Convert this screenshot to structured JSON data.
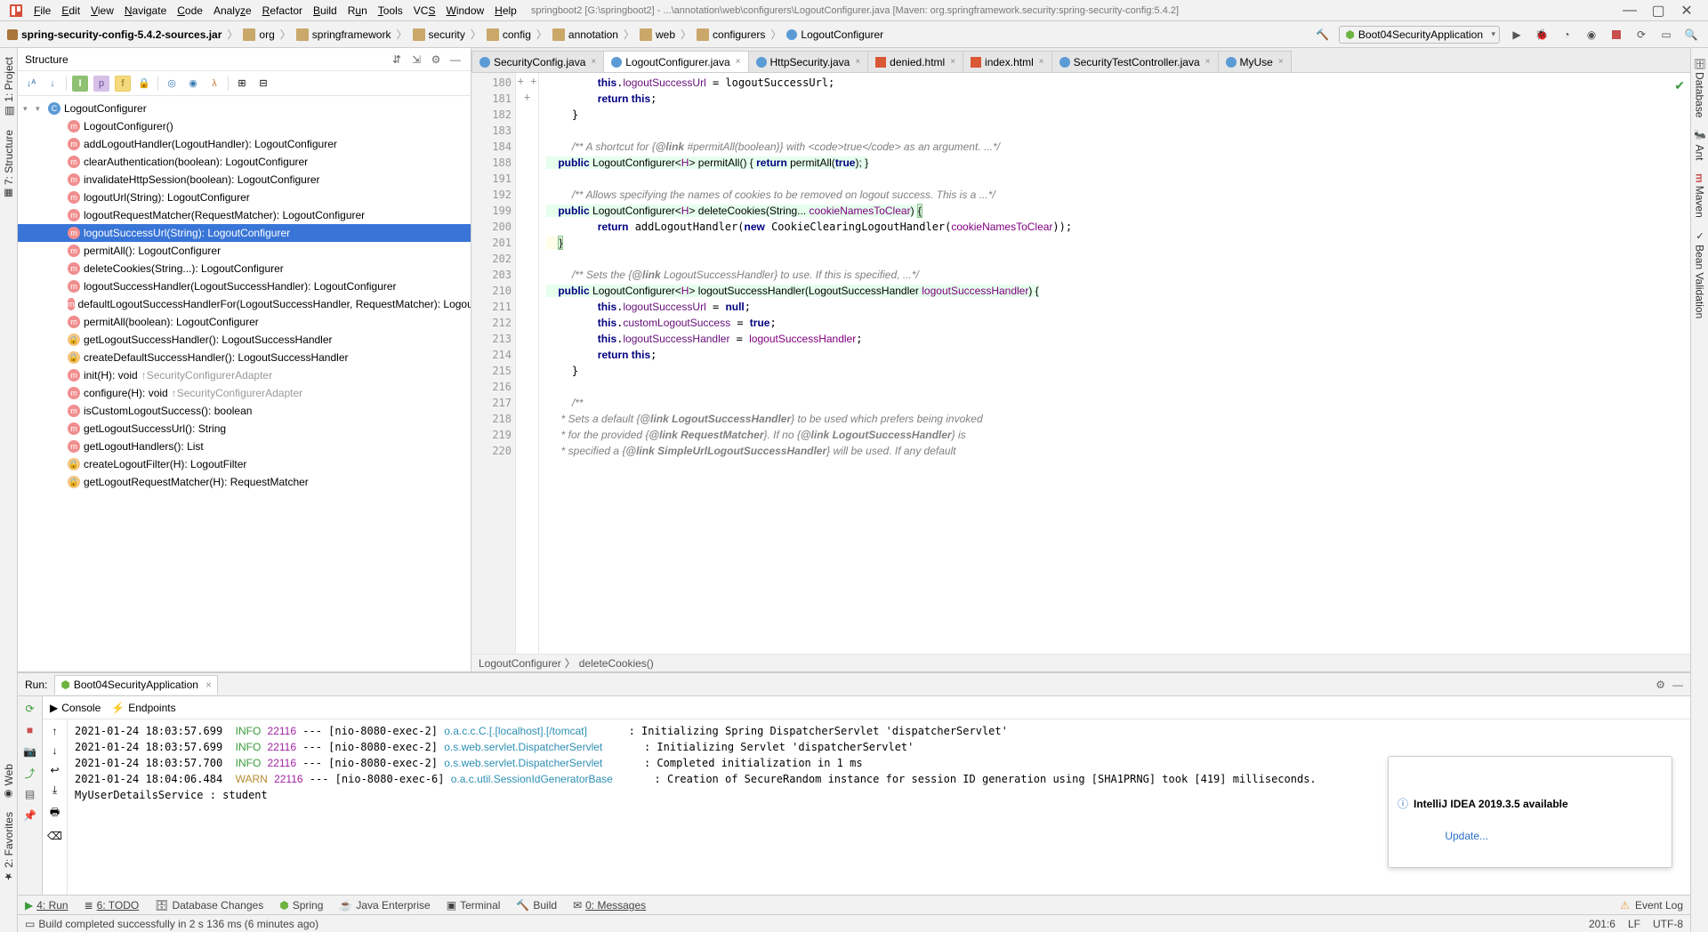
{
  "window": {
    "title": "springboot2 [G:\\springboot2] - ...\\annotation\\web\\configurers\\LogoutConfigurer.java [Maven: org.springframework.security:spring-security-config:5.4.2]"
  },
  "menu": [
    "File",
    "Edit",
    "View",
    "Navigate",
    "Code",
    "Analyze",
    "Refactor",
    "Build",
    "Run",
    "Tools",
    "VCS",
    "Window",
    "Help"
  ],
  "breadcrumbs": [
    "spring-security-config-5.4.2-sources.jar",
    "org",
    "springframework",
    "security",
    "config",
    "annotation",
    "web",
    "configurers",
    "LogoutConfigurer"
  ],
  "runConfig": "Boot04SecurityApplication",
  "leftRail": [
    "1: Project",
    "7: Structure"
  ],
  "rightRail": [
    "Database",
    "Ant",
    "Maven",
    "Bean Validation"
  ],
  "leftRailLower": [
    "2: Favorites",
    "Web"
  ],
  "structure": {
    "title": "Structure",
    "root": "LogoutConfigurer",
    "items": [
      {
        "icon": "m",
        "label": "LogoutConfigurer()"
      },
      {
        "icon": "m",
        "label": "addLogoutHandler(LogoutHandler): LogoutConfigurer<H>"
      },
      {
        "icon": "m",
        "label": "clearAuthentication(boolean): LogoutConfigurer<H>"
      },
      {
        "icon": "m",
        "label": "invalidateHttpSession(boolean): LogoutConfigurer<H>"
      },
      {
        "icon": "m",
        "label": "logoutUrl(String): LogoutConfigurer<H>"
      },
      {
        "icon": "m",
        "label": "logoutRequestMatcher(RequestMatcher): LogoutConfigurer<H>"
      },
      {
        "icon": "m",
        "label": "logoutSuccessUrl(String): LogoutConfigurer<H>",
        "selected": true
      },
      {
        "icon": "m",
        "label": "permitAll(): LogoutConfigurer<H>"
      },
      {
        "icon": "m",
        "label": "deleteCookies(String...): LogoutConfigurer<H>"
      },
      {
        "icon": "m",
        "label": "logoutSuccessHandler(LogoutSuccessHandler): LogoutConfigurer<H>"
      },
      {
        "icon": "m",
        "label": "defaultLogoutSuccessHandlerFor(LogoutSuccessHandler, RequestMatcher): LogoutC"
      },
      {
        "icon": "m",
        "label": "permitAll(boolean): LogoutConfigurer<H>"
      },
      {
        "icon": "l",
        "label": "getLogoutSuccessHandler(): LogoutSuccessHandler"
      },
      {
        "icon": "l",
        "label": "createDefaultSuccessHandler(): LogoutSuccessHandler"
      },
      {
        "icon": "m",
        "label": "init(H): void",
        "sub": "↑SecurityConfigurerAdapter"
      },
      {
        "icon": "m",
        "label": "configure(H): void",
        "sub": "↑SecurityConfigurerAdapter"
      },
      {
        "icon": "m",
        "label": "isCustomLogoutSuccess(): boolean"
      },
      {
        "icon": "m",
        "label": "getLogoutSuccessUrl(): String"
      },
      {
        "icon": "m",
        "label": "getLogoutHandlers(): List<LogoutHandler>"
      },
      {
        "icon": "l",
        "label": "createLogoutFilter(H): LogoutFilter"
      },
      {
        "icon": "l",
        "label": "getLogoutRequestMatcher(H): RequestMatcher"
      }
    ]
  },
  "tabs": [
    {
      "label": "SecurityConfig.java",
      "type": "c"
    },
    {
      "label": "LogoutConfigurer.java",
      "type": "c",
      "active": true
    },
    {
      "label": "HttpSecurity.java",
      "type": "c"
    },
    {
      "label": "denied.html",
      "type": "h"
    },
    {
      "label": "index.html",
      "type": "h"
    },
    {
      "label": "SecurityTestController.java",
      "type": "c"
    },
    {
      "label": "MyUse",
      "type": "c"
    }
  ],
  "lineNums": [
    "180",
    "181",
    "182",
    "183",
    "184",
    "188",
    "191",
    "192",
    "199",
    "200",
    "201",
    "202",
    "203",
    "210",
    "211",
    "212",
    "213",
    "214",
    "215",
    "216",
    "217",
    "218",
    "219",
    "220"
  ],
  "plusLines": {
    "188": "+",
    "199": "+",
    "210": "+"
  },
  "codeBreadcrumb": [
    "LogoutConfigurer",
    "deleteCookies()"
  ],
  "run": {
    "title": "Run:",
    "tab": "Boot04SecurityApplication",
    "subtabs": [
      "Console",
      "Endpoints"
    ],
    "lines": [
      {
        "ts": "2021-01-24 18:03:57.699",
        "lvl": "INFO",
        "pid": "22116",
        "th": "[nio-8080-exec-2]",
        "cls": "o.a.c.c.C.[.[localhost].[/tomcat]",
        "msg": "Initializing Spring DispatcherServlet 'dispatcherServlet'"
      },
      {
        "ts": "2021-01-24 18:03:57.699",
        "lvl": "INFO",
        "pid": "22116",
        "th": "[nio-8080-exec-2]",
        "cls": "o.s.web.servlet.DispatcherServlet",
        "msg": "Initializing Servlet 'dispatcherServlet'"
      },
      {
        "ts": "2021-01-24 18:03:57.700",
        "lvl": "INFO",
        "pid": "22116",
        "th": "[nio-8080-exec-2]",
        "cls": "o.s.web.servlet.DispatcherServlet",
        "msg": "Completed initialization in 1 ms"
      },
      {
        "ts": "2021-01-24 18:04:06.484",
        "lvl": "WARN",
        "pid": "22116",
        "th": "[nio-8080-exec-6]",
        "cls": "o.a.c.util.SessionIdGeneratorBase",
        "msg": "Creation of SecureRandom instance for session ID generation using [SHA1PRNG] took [419] milliseconds."
      }
    ],
    "extraLine": "MyUserDetailsService : student"
  },
  "notification": {
    "title": "IntelliJ IDEA 2019.3.5 available",
    "link": "Update..."
  },
  "bottomTabs": [
    "4: Run",
    "6: TODO",
    "Database Changes",
    "Spring",
    "Java Enterprise",
    "Terminal",
    "Build",
    "0: Messages"
  ],
  "bottomRight": "Event Log",
  "statusBar": {
    "msg": "Build completed successfully in 2 s 136 ms (6 minutes ago)",
    "pos": "201:6",
    "eol": "LF",
    "enc": "UTF-8"
  }
}
